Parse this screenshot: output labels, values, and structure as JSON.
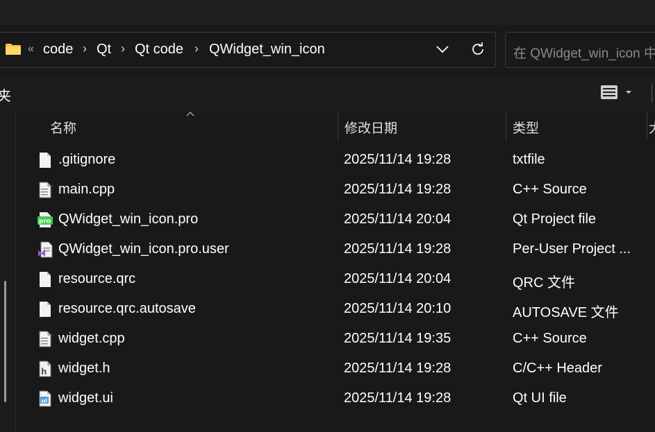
{
  "address": {
    "overflow_chevron": "«",
    "breadcrumbs": [
      "code",
      "Qt",
      "Qt code",
      "QWidget_win_icon"
    ],
    "separator": "›"
  },
  "search": {
    "placeholder": "在 QWidget_win_icon 中搜索"
  },
  "commandbar": {
    "partial_label": "夹"
  },
  "columns": {
    "name": "名称",
    "date": "修改日期",
    "type": "类型",
    "extra": "大"
  },
  "files": [
    {
      "name": ".gitignore",
      "date": "2025/11/14 19:28",
      "type": "txtfile",
      "icon": "text-file-icon"
    },
    {
      "name": "main.cpp",
      "date": "2025/11/14 19:28",
      "type": "C++ Source",
      "icon": "cpp-file-icon"
    },
    {
      "name": "QWidget_win_icon.pro",
      "date": "2025/11/14 20:04",
      "type": "Qt Project file",
      "icon": "qt-pro-file-icon"
    },
    {
      "name": "QWidget_win_icon.pro.user",
      "date": "2025/11/14 19:28",
      "type": "Per-User Project ...",
      "icon": "visual-studio-file-icon"
    },
    {
      "name": "resource.qrc",
      "date": "2025/11/14 20:04",
      "type": "QRC 文件",
      "icon": "text-file-icon"
    },
    {
      "name": "resource.qrc.autosave",
      "date": "2025/11/14 20:10",
      "type": "AUTOSAVE 文件",
      "icon": "text-file-icon"
    },
    {
      "name": "widget.cpp",
      "date": "2025/11/14 19:35",
      "type": "C++ Source",
      "icon": "cpp-file-icon"
    },
    {
      "name": "widget.h",
      "date": "2025/11/14 19:28",
      "type": "C/C++ Header",
      "icon": "header-file-icon"
    },
    {
      "name": "widget.ui",
      "date": "2025/11/14 19:28",
      "type": "Qt UI file",
      "icon": "qt-ui-file-icon"
    }
  ],
  "colors": {
    "background": "#191919",
    "folder": "#f5c451",
    "qt_green": "#41cd52",
    "vs_purple": "#8b5bd6",
    "cpp_accent": "#a76bd6",
    "ui_blue": "#4b9fd8"
  }
}
